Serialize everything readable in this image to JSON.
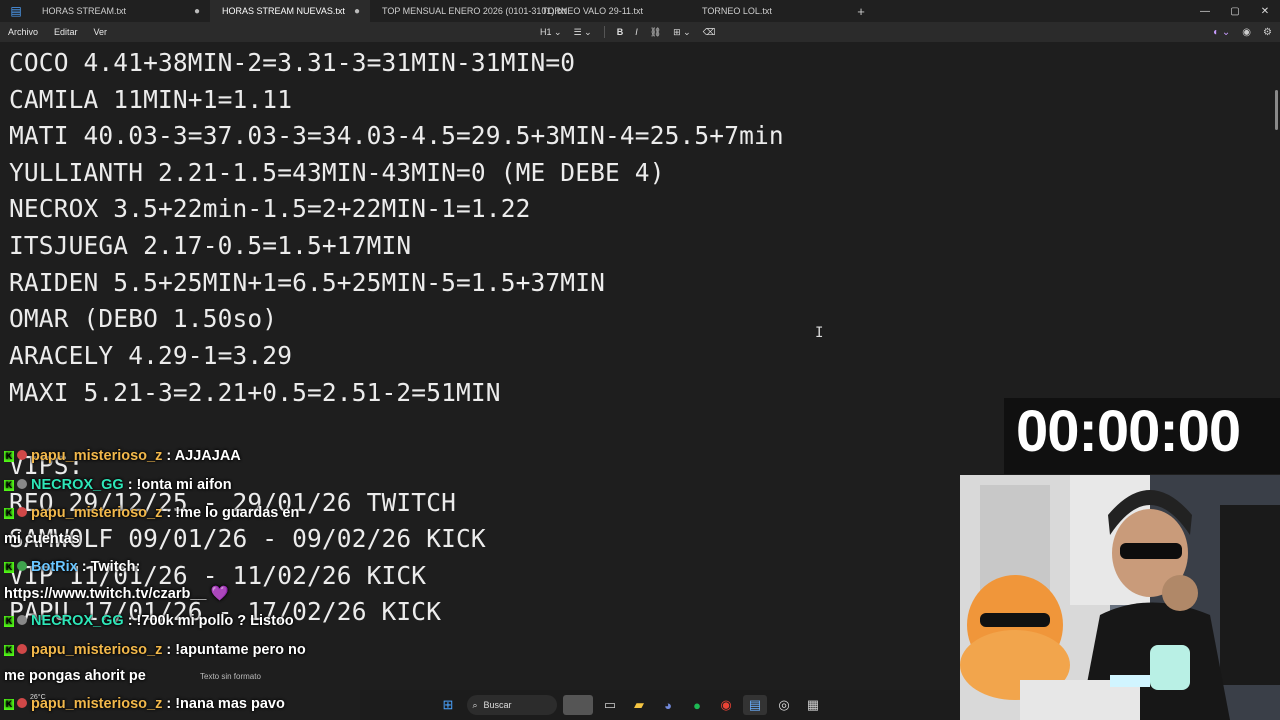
{
  "tabs": [
    {
      "label": "HORAS STREAM.txt",
      "modified": true
    },
    {
      "label": "HORAS STREAM NUEVAS.txt",
      "modified": true
    },
    {
      "label": "TOP MENSUAL ENERO 2026 (0101-3101).txt",
      "modified": false
    },
    {
      "label": "TORNEO VALO 29-11.txt",
      "modified": false
    },
    {
      "label": "TORNEO LOL.txt",
      "modified": false
    }
  ],
  "window_controls": [
    "—",
    "▢",
    "✕"
  ],
  "menu": [
    "Archivo",
    "Editar",
    "Ver"
  ],
  "toolbar": {
    "heading": "H1"
  },
  "editor_lines": [
    "COCO 4.41+38MIN-2=3.31-3=31MIN-31MIN=0",
    "CAMILA 11MIN+1=1.11",
    "MATI 40.03-3=37.03-3=34.03-4.5=29.5+3MIN-4=25.5+7min",
    "YULLIANTH 2.21-1.5=43MIN-43MIN=0 (ME DEBE 4)",
    "NECROX 3.5+22min-1.5=2+22MIN-1=1.22",
    "ITSJUEGA 2.17-0.5=1.5+17MIN",
    "RAIDEN 5.5+25MIN+1=6.5+25MIN-5=1.5+37MIN",
    "OMAR (DEBO 1.50so)",
    "ARACELY 4.29-1=3.29",
    "MAXI 5.21-3=2.21+0.5=2.51-2=51MIN",
    "",
    "VIPS:",
    "REO 29/12/25 - 29/01/26 TWITCH",
    "SAMWOLF 09/01/26 - 09/02/26 KICK",
    "VIP 11/01/26 - 11/02/26 KICK",
    "PAPU 17/01/26 - 17/02/26 KICK"
  ],
  "timer": "00:00:00",
  "chat": [
    {
      "user": "papu_misterioso_z",
      "text": ": AJJAJAA",
      "platform": "kick"
    },
    {
      "user": "NECROX_GG",
      "text": ": !onta mi aifon",
      "platform": "kick"
    },
    {
      "user": "papu_misterioso_z",
      "text": ": !me lo guardas en",
      "platform": "kick"
    },
    {
      "user": "",
      "text": "mi cuentas",
      "platform": ""
    },
    {
      "user": "BotRix",
      "text": ": Twitch:",
      "platform": "kick"
    },
    {
      "user": "",
      "text": "https://www.twitch.tv/czarb__ 💜",
      "platform": ""
    },
    {
      "user": "NECROX_GG",
      "text": ": !700k mi pollo ? Listoo",
      "platform": "kick"
    },
    {
      "user": "papu_misterioso_z",
      "text": ": !apuntame pero no",
      "platform": "kick"
    },
    {
      "user": "",
      "text": "me pongas ahorit pe",
      "platform": ""
    },
    {
      "user": "papu_misterioso_z",
      "text": ": !nana mas pavo",
      "platform": "kick"
    }
  ],
  "status_text": "Texto sin formato",
  "taskbar": {
    "search_placeholder": "Buscar",
    "weather": "26°C"
  },
  "colors": {
    "bg": "#1e1e1e",
    "text": "#ececec",
    "kick_green": "#53fc18",
    "papu": "#f2b84b",
    "necrox": "#2ee6b8"
  }
}
